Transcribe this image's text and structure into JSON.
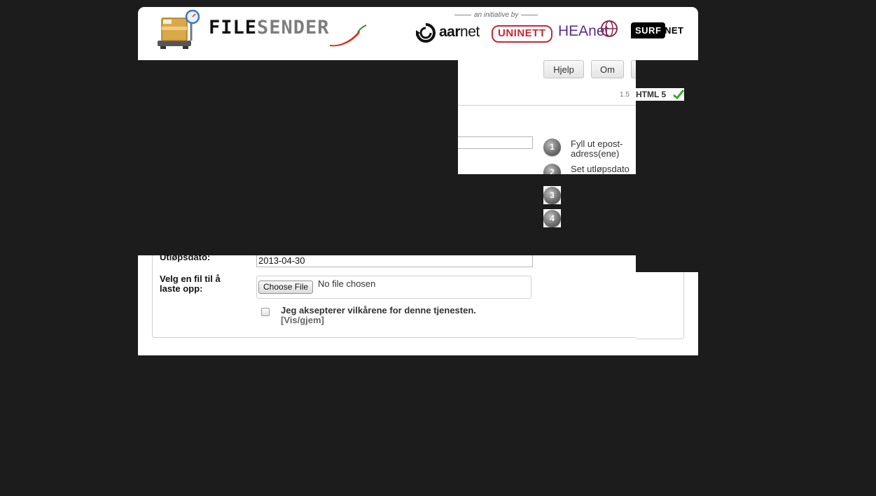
{
  "header": {
    "wordmark_part1": "FILE",
    "wordmark_part2": "SENDER",
    "initiative_text": "an initiative by",
    "partners": {
      "aarnet_bold": "aar",
      "aarnet_light": "net",
      "uninett": "UNINETT",
      "heanet": "HEAnet",
      "surf": "SURF",
      "net": "NET"
    },
    "icons": [
      "parcel-scale-icon",
      "chili-pepper-icon",
      "aarnet-logo-icon",
      "heanet-globe-icon",
      "html5-check-icon"
    ]
  },
  "nav": {
    "help_label": "Hjelp",
    "about_label": "Om"
  },
  "version": {
    "number": "1.5",
    "html5_label": "HTML 5"
  },
  "steps": [
    {
      "number": "1",
      "label_line1": "Fyll ut epost-",
      "label_line2": "adress(ene)"
    },
    {
      "number": "2",
      "label": "Set utløpsdato"
    },
    {
      "number": "3"
    },
    {
      "number": "4"
    }
  ],
  "form": {
    "expiry_label": "Utløpsdato:",
    "expiry_value": "2013-04-30",
    "file_label_line1": "Velg en fil til å",
    "file_label_line2": "laste opp:",
    "choose_file_label": "Choose File",
    "no_file_text": "No file chosen",
    "terms_text": "Jeg aksepterer vilkårene for denne tjenesten.",
    "terms_toggle": "[Vis/gjem]"
  },
  "colors": {
    "background": "#1c1c1c",
    "panel": "#ffffff",
    "uninett_red": "#c6283a",
    "heanet_purple": "#5b2f86",
    "html5_check": "#3aa635"
  }
}
